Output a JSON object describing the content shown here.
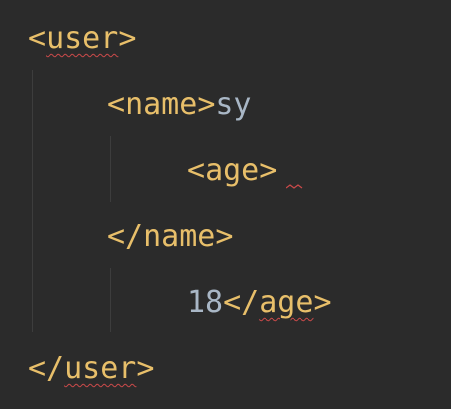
{
  "editor": {
    "lines": [
      {
        "open": "<",
        "name": "user",
        "close": ">",
        "text": ""
      },
      {
        "open": "<",
        "name": "name",
        "close": ">",
        "text": "sy"
      },
      {
        "open": "<",
        "name": "age",
        "close": ">",
        "text": ""
      },
      {
        "open": "</",
        "name": "name",
        "close": ">",
        "text": ""
      },
      {
        "text": "18",
        "open": "</",
        "name": "age",
        "close": ">"
      },
      {
        "open": "</",
        "name": "user",
        "close": ">",
        "text": ""
      }
    ]
  },
  "colors": {
    "background": "#2b2b2b",
    "tag": "#e8bf6a",
    "text": "#a9b7c6",
    "error_underline": "#cc4a4a",
    "indent_guide": "#3d3d3d"
  }
}
